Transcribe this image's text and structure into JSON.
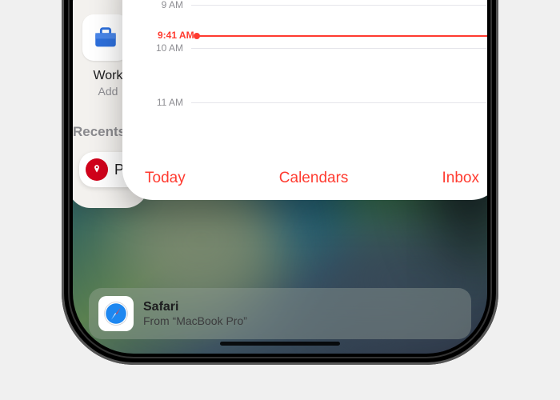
{
  "calendar": {
    "hours": {
      "h9": "9 AM",
      "h10": "10 AM",
      "h11": "11 AM"
    },
    "current_time_label": "9:41 AM",
    "toolbar": {
      "today": "Today",
      "calendars": "Calendars",
      "inbox": "Inbox"
    }
  },
  "work_focus": {
    "title": "Work",
    "subtitle": "Add"
  },
  "recents_label": "Recents",
  "pin_chip_label": "P",
  "handoff": {
    "app_name": "Safari",
    "from_line": "From “MacBook Pro”"
  },
  "colors": {
    "accent_red": "#ff3b30",
    "safari_blue": "#1e87f0"
  }
}
